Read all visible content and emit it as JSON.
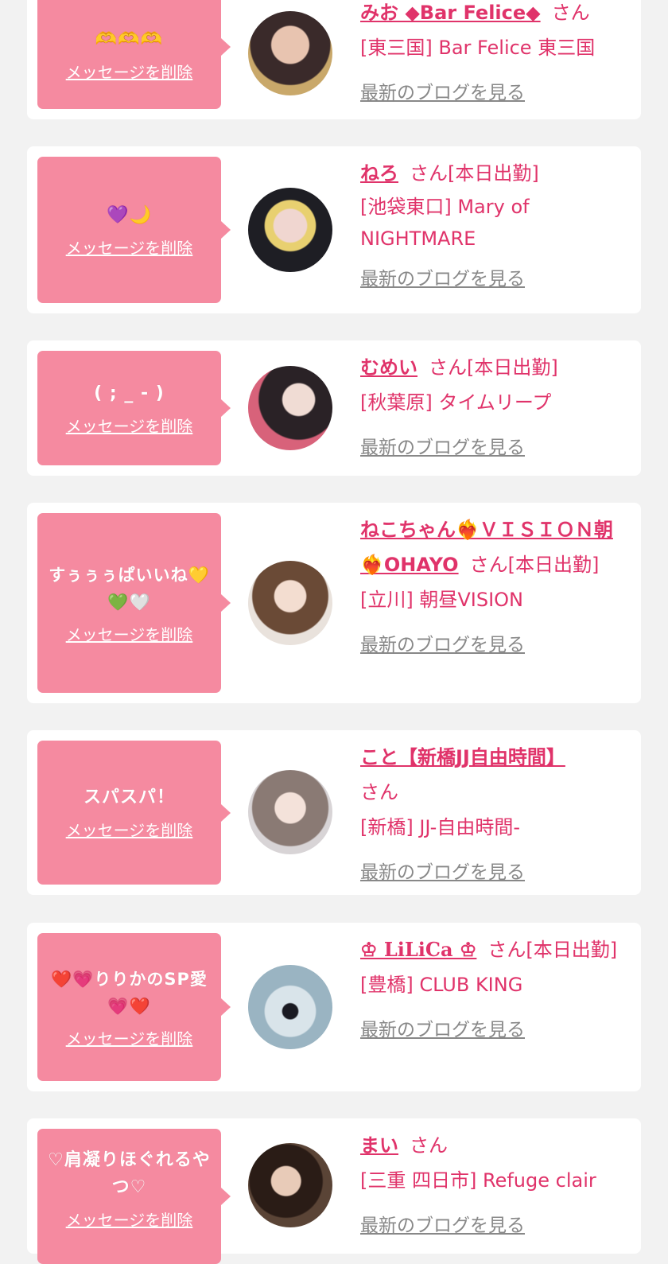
{
  "delete_label": "メッセージを削除",
  "blog_label": "最新のブログを見る",
  "san_label": "さん",
  "colors": {
    "accent": "#e0336a",
    "bubble": "#f58aa0",
    "background": "#f2f2f2"
  },
  "cards": [
    {
      "message": "🫶🫶🫶",
      "name": "みお ◆Bar Felice◆",
      "status": "",
      "shop": "[東三国] Bar Felice 東三国"
    },
    {
      "message": "💜🌙",
      "name": "ねろ",
      "status": "[本日出勤]",
      "shop": "[池袋東口] Mary of NIGHTMARE"
    },
    {
      "message": "( ; _ - )",
      "name": "むめい",
      "status": "[本日出勤]",
      "shop": "[秋葉原] タイムリープ"
    },
    {
      "message": "すぅぅぅぱいいね💛💚🤍",
      "name": "ねこちゃん❤️‍🔥ＶＩＳＩＯＮ朝❤️‍🔥OHAYO",
      "status": "[本日出勤]",
      "shop": "[立川] 朝昼VISION"
    },
    {
      "message": "スパスパ！",
      "name": "こと【新橋JJ自由時間】",
      "status": "",
      "shop": "[新橋] JJ-自由時間-"
    },
    {
      "message": "❤️💗りりかのSP愛💗❤️",
      "name": "♔ LiLiCa ♔",
      "status": "[本日出勤]",
      "shop": "[豊橋] CLUB KING"
    },
    {
      "message": "♡肩凝りほぐれるやつ♡",
      "name": "まい",
      "status": "",
      "shop": "[三重 四日市] Refuge clair"
    }
  ]
}
